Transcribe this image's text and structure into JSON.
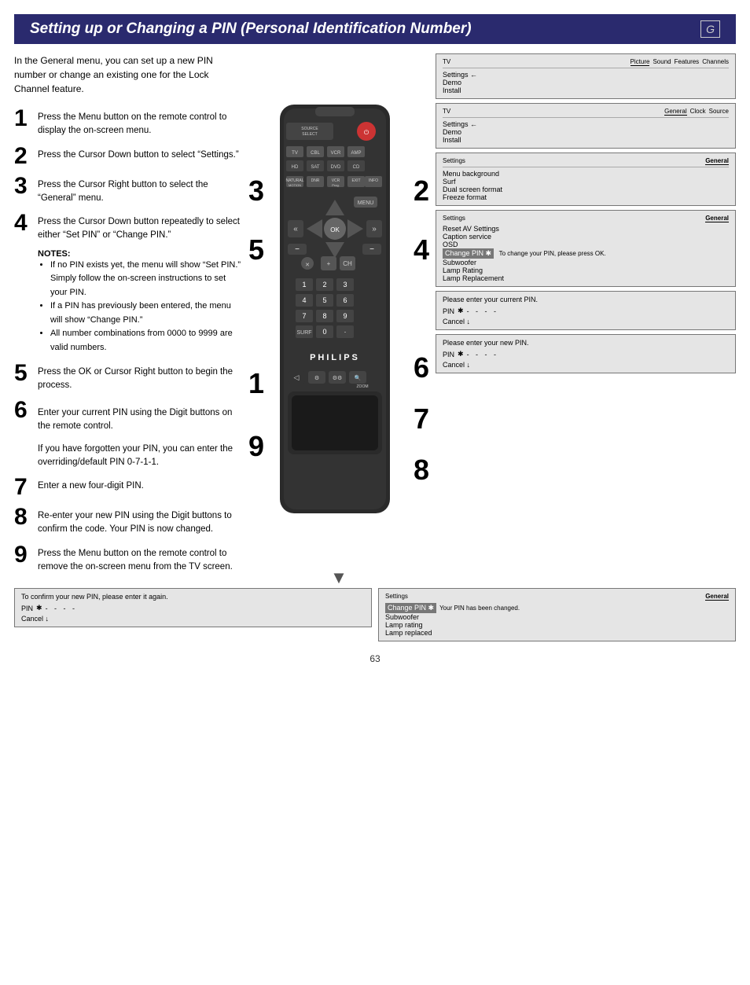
{
  "header": {
    "title": "Setting up or Changing a PIN (Personal Identification Number)",
    "letter": "G"
  },
  "intro": "In the General menu, you can set up a new PIN number or change an existing one for the Lock Channel feature.",
  "steps": [
    {
      "num": "1",
      "text": "Press the Menu button on the remote control to display the on-screen menu."
    },
    {
      "num": "2",
      "text": "Press the Cursor Down button to select “Settings.”"
    },
    {
      "num": "3",
      "text": "Press the Cursor Right button to select the “General” menu."
    },
    {
      "num": "4",
      "text": "Press the Cursor Down button repeatedly to select either “Set PIN” or “Change PIN.”"
    },
    {
      "num": "5",
      "text": "Press the OK or Cursor Right button to begin the process."
    },
    {
      "num": "6",
      "text_a": "Enter your current PIN using the Digit buttons on the remote control.",
      "text_b": "If you have forgotten your PIN, you can enter the overriding/default PIN 0-7-1-1."
    },
    {
      "num": "7",
      "text": "Enter a new four-digit PIN."
    },
    {
      "num": "8",
      "text": "Re-enter your new PIN using the Digit buttons to confirm the code. Your PIN is now changed."
    },
    {
      "num": "9",
      "text": "Press the Menu button on the remote control to remove the on-screen menu from the TV screen."
    }
  ],
  "notes": {
    "heading": "NOTES:",
    "items": [
      "If no PIN exists yet, the menu will show “Set PIN.” Simply follow the on-screen instructions to set your PIN.",
      "If a PIN has previously been entered, the menu will show “Change PIN.”",
      "All number combinations from 0000 to 9999 are valid numbers."
    ]
  },
  "screens": {
    "screen1": {
      "tabs": [
        "Picture",
        "Sound",
        "Features",
        "Channels"
      ],
      "active_tab": "",
      "label": "TV",
      "items": [
        "Settings",
        "Demo",
        "Install"
      ],
      "note": ""
    },
    "screen2": {
      "tabs": [
        "General",
        "Clock",
        "Source"
      ],
      "label": "TV",
      "sublabel": "Settings",
      "items": [
        "Demo",
        "Install"
      ],
      "note": ""
    },
    "screen3": {
      "tabs": [
        "General"
      ],
      "label": "Settings",
      "items": [
        "Menu background",
        "Surf",
        "Dual screen format",
        "Freeze format"
      ],
      "note": ""
    },
    "screen4": {
      "label": "Settings",
      "items": [
        "Reset AV Settings",
        "Caption service",
        "OSD",
        "Change PIN",
        "Subwoofer",
        "Lamp Rating",
        "Lamp Replacement"
      ],
      "selected": "Change PIN",
      "note": "To change your PIN, please press OK."
    },
    "screen5": {
      "label": "Please enter your current PIN.",
      "pin_label": "PIN",
      "cancel_label": "Cancel",
      "dashes": "- - - -"
    },
    "screen6": {
      "label": "Please enter your new PIN.",
      "pin_label": "PIN",
      "cancel_label": "Cancel",
      "dashes": "- - - -"
    },
    "screen7": {
      "label": "To confirm your new PIN, please enter it again.",
      "pin_label": "PIN",
      "cancel_label": "Cancel",
      "dashes": "- - - -"
    },
    "screen8": {
      "label": "Settings",
      "items": [
        "Change PIN",
        "Subwoofer",
        "Lamp rating",
        "Lamp replaced"
      ],
      "selected": "Change PIN",
      "note": "Your PIN has been changed."
    }
  },
  "overlay_numbers": {
    "top_left": [
      "3",
      "5"
    ],
    "top_right": [
      "2",
      "4"
    ],
    "bottom_left": [
      "1",
      "9"
    ],
    "bottom_right": [
      "6",
      "7",
      "8"
    ]
  },
  "page_number": "63",
  "philips": "PHILIPS"
}
